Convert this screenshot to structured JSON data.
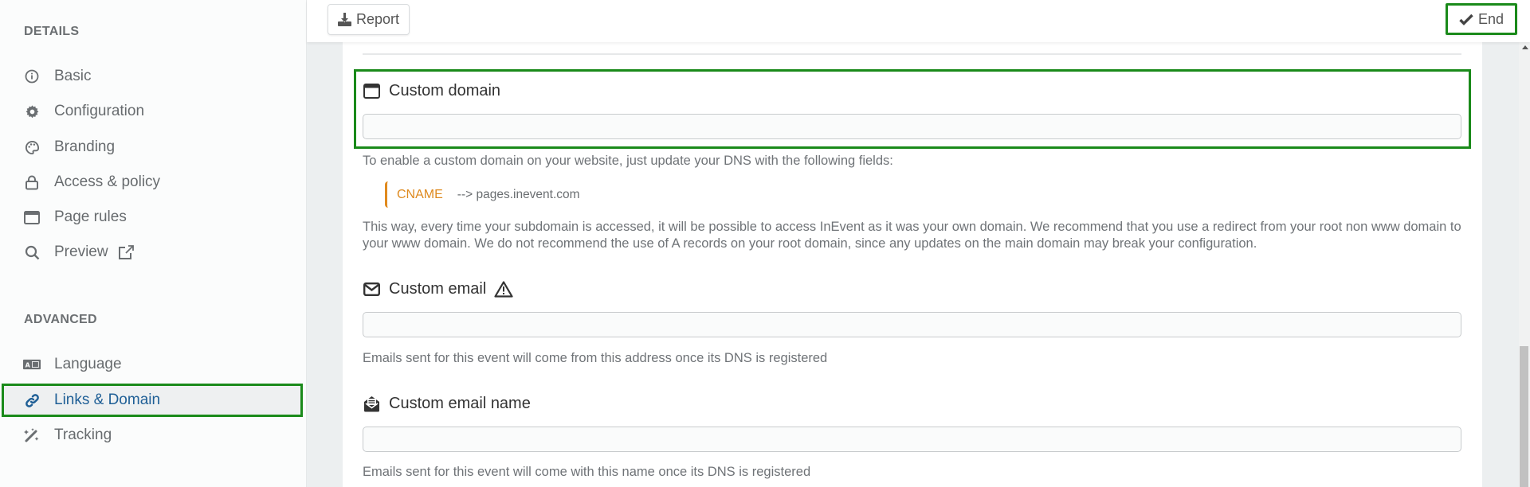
{
  "sidebar": {
    "details_heading": "DETAILS",
    "details_items": [
      {
        "label": "Basic",
        "icon": "info-circle-icon"
      },
      {
        "label": "Configuration",
        "icon": "gear-icon"
      },
      {
        "label": "Branding",
        "icon": "palette-icon"
      },
      {
        "label": "Access & policy",
        "icon": "lock-icon"
      },
      {
        "label": "Page rules",
        "icon": "window-icon"
      },
      {
        "label": "Preview",
        "icon": "search-icon",
        "trailing_icon": "external-link-icon"
      }
    ],
    "advanced_heading": "ADVANCED",
    "advanced_items": [
      {
        "label": "Language",
        "icon": "language-icon"
      },
      {
        "label": "Links & Domain",
        "icon": "link-icon",
        "active": true
      },
      {
        "label": "Tracking",
        "icon": "magic-wand-icon"
      }
    ]
  },
  "toolbar": {
    "report_label": "Report",
    "end_label": "End"
  },
  "main": {
    "custom_domain": {
      "title": "Custom domain",
      "value": "",
      "placeholder": "",
      "help": "To enable a custom domain on your website, just update your DNS with the following fields:",
      "record_type": "CNAME",
      "record_value": "--> pages.inevent.com",
      "note": "This way, every time your subdomain is accessed, it will be possible to access InEvent as it was your own domain. We recommend that you use a redirect from your root non www domain to your www domain. We do not recommend the use of A records on your root domain, since any updates on the main domain may break your configuration."
    },
    "custom_email": {
      "title": "Custom email",
      "value": "",
      "placeholder": "",
      "help": "Emails sent for this event will come from this address once its DNS is registered"
    },
    "custom_email_name": {
      "title": "Custom email name",
      "value": "",
      "placeholder": "",
      "help": "Emails sent for this event will come with this name once its DNS is registered"
    }
  },
  "colors": {
    "highlight": "#1a8a1a",
    "active_nav": "#1f5f96",
    "cname": "#de8a1f"
  }
}
